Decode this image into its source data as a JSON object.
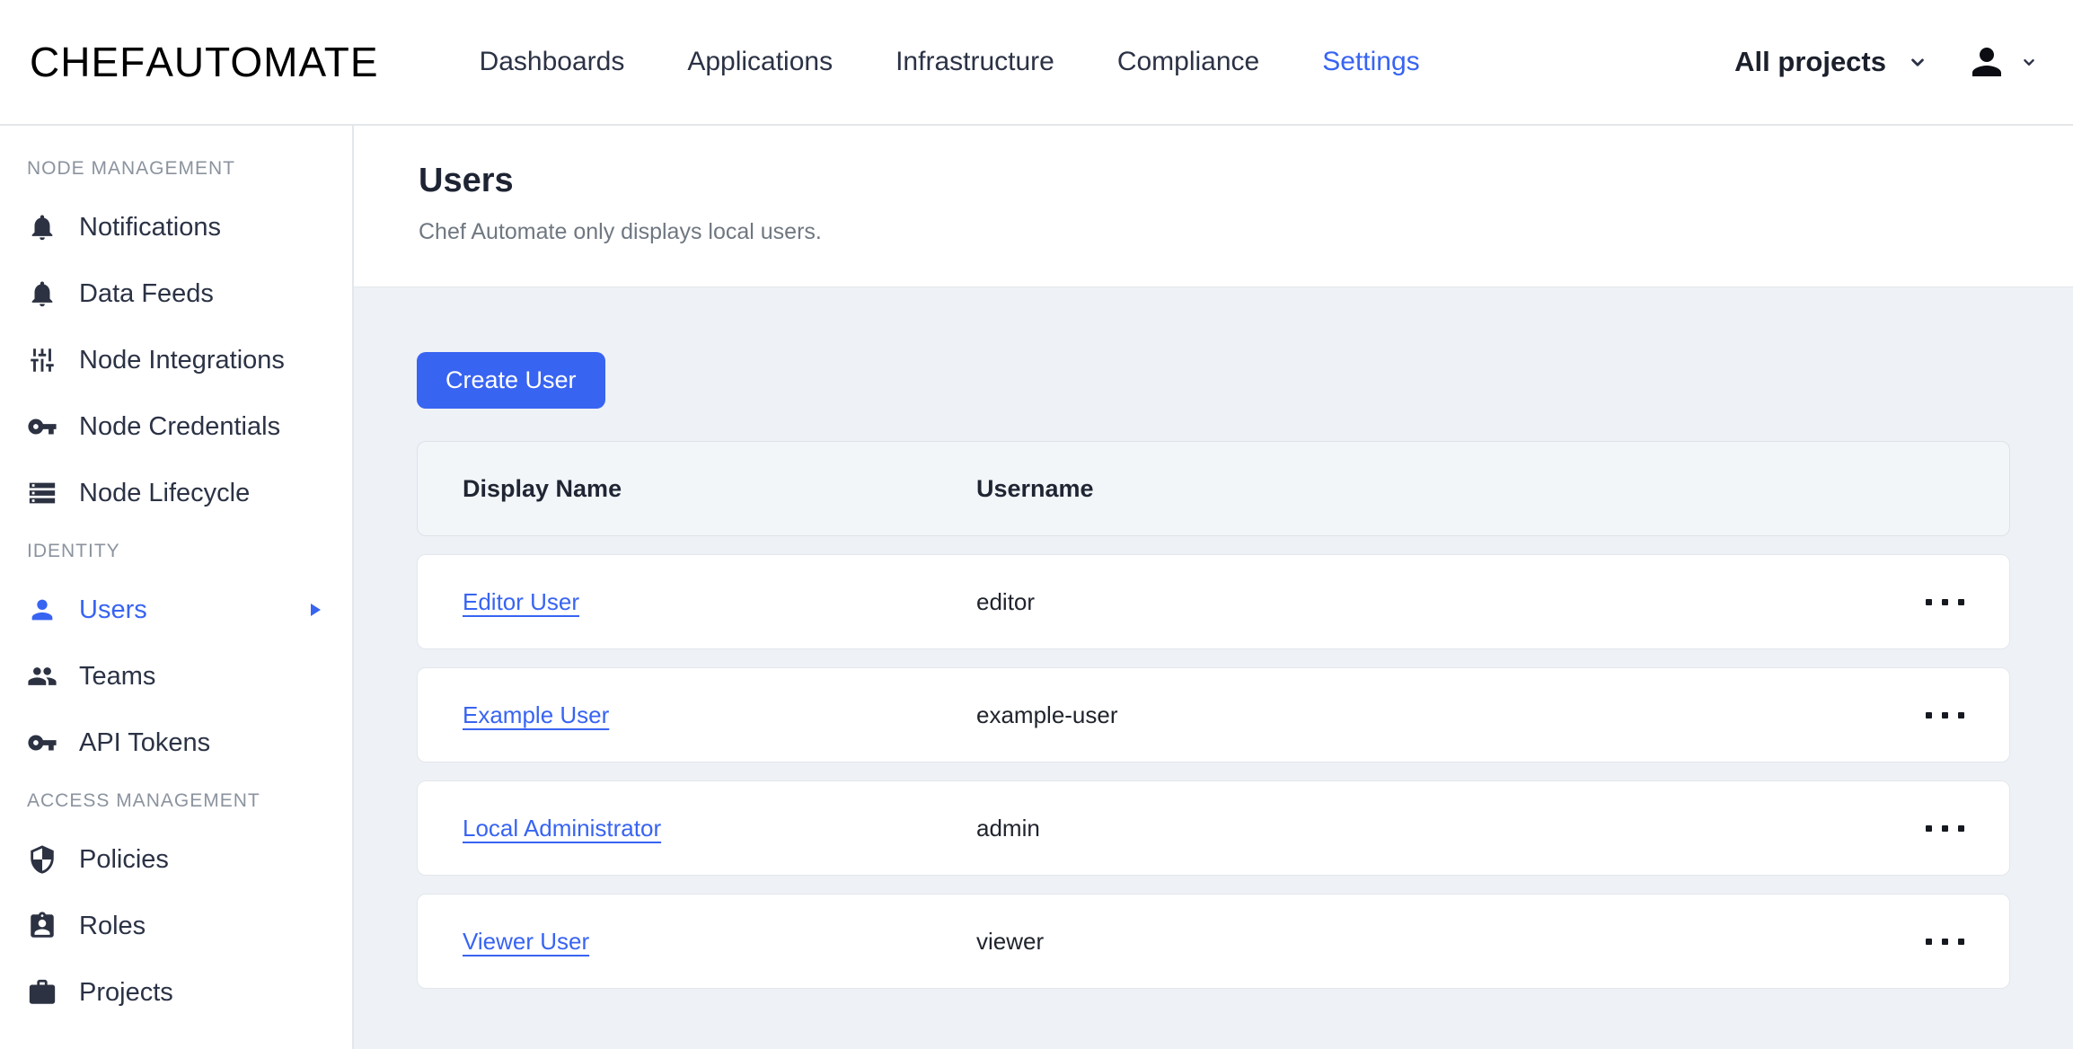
{
  "topbar": {
    "logo": {
      "part1": "CHEF",
      "part2": "AUTOMATE"
    },
    "nav": [
      {
        "label": "Dashboards",
        "active": false
      },
      {
        "label": "Applications",
        "active": false
      },
      {
        "label": "Infrastructure",
        "active": false
      },
      {
        "label": "Compliance",
        "active": false
      },
      {
        "label": "Settings",
        "active": true
      }
    ],
    "projects_filter": {
      "label": "All projects",
      "icon": "chevron-down-icon"
    },
    "user_menu": {
      "icon": "user-avatar-icon",
      "chevron": "chevron-down-icon"
    }
  },
  "sidebar": {
    "sections": [
      {
        "label": "NODE MANAGEMENT",
        "items": [
          {
            "icon": "bell-icon",
            "label": "Notifications"
          },
          {
            "icon": "bell-icon",
            "label": "Data Feeds"
          },
          {
            "icon": "sliders-icon",
            "label": "Node Integrations"
          },
          {
            "icon": "key-icon",
            "label": "Node Credentials"
          },
          {
            "icon": "list-icon",
            "label": "Node Lifecycle"
          }
        ]
      },
      {
        "label": "IDENTITY",
        "items": [
          {
            "icon": "person-icon",
            "label": "Users",
            "active": true,
            "arrow": "arrow-right-icon"
          },
          {
            "icon": "people-icon",
            "label": "Teams"
          },
          {
            "icon": "key-icon",
            "label": "API Tokens"
          }
        ]
      },
      {
        "label": "ACCESS MANAGEMENT",
        "items": [
          {
            "icon": "shield-icon",
            "label": "Policies"
          },
          {
            "icon": "badge-icon",
            "label": "Roles"
          },
          {
            "icon": "briefcase-icon",
            "label": "Projects"
          }
        ]
      }
    ]
  },
  "page": {
    "title": "Users",
    "description": "Chef Automate only displays local users."
  },
  "actions": {
    "create_user_label": "Create User"
  },
  "table": {
    "columns": [
      "Display Name",
      "Username"
    ],
    "row_menu_icon": "more-options-icon",
    "rows": [
      {
        "display_name": "Editor User",
        "username": "editor"
      },
      {
        "display_name": "Example User",
        "username": "example-user"
      },
      {
        "display_name": "Local Administrator",
        "username": "admin"
      },
      {
        "display_name": "Viewer User",
        "username": "viewer"
      }
    ]
  },
  "colors": {
    "primary_blue": "#3864f2",
    "brand_orange": "#f4622d",
    "dark_navy": "#2b3245",
    "page_background": "#eef1f6",
    "table_header_background": "#f3f6f9"
  }
}
